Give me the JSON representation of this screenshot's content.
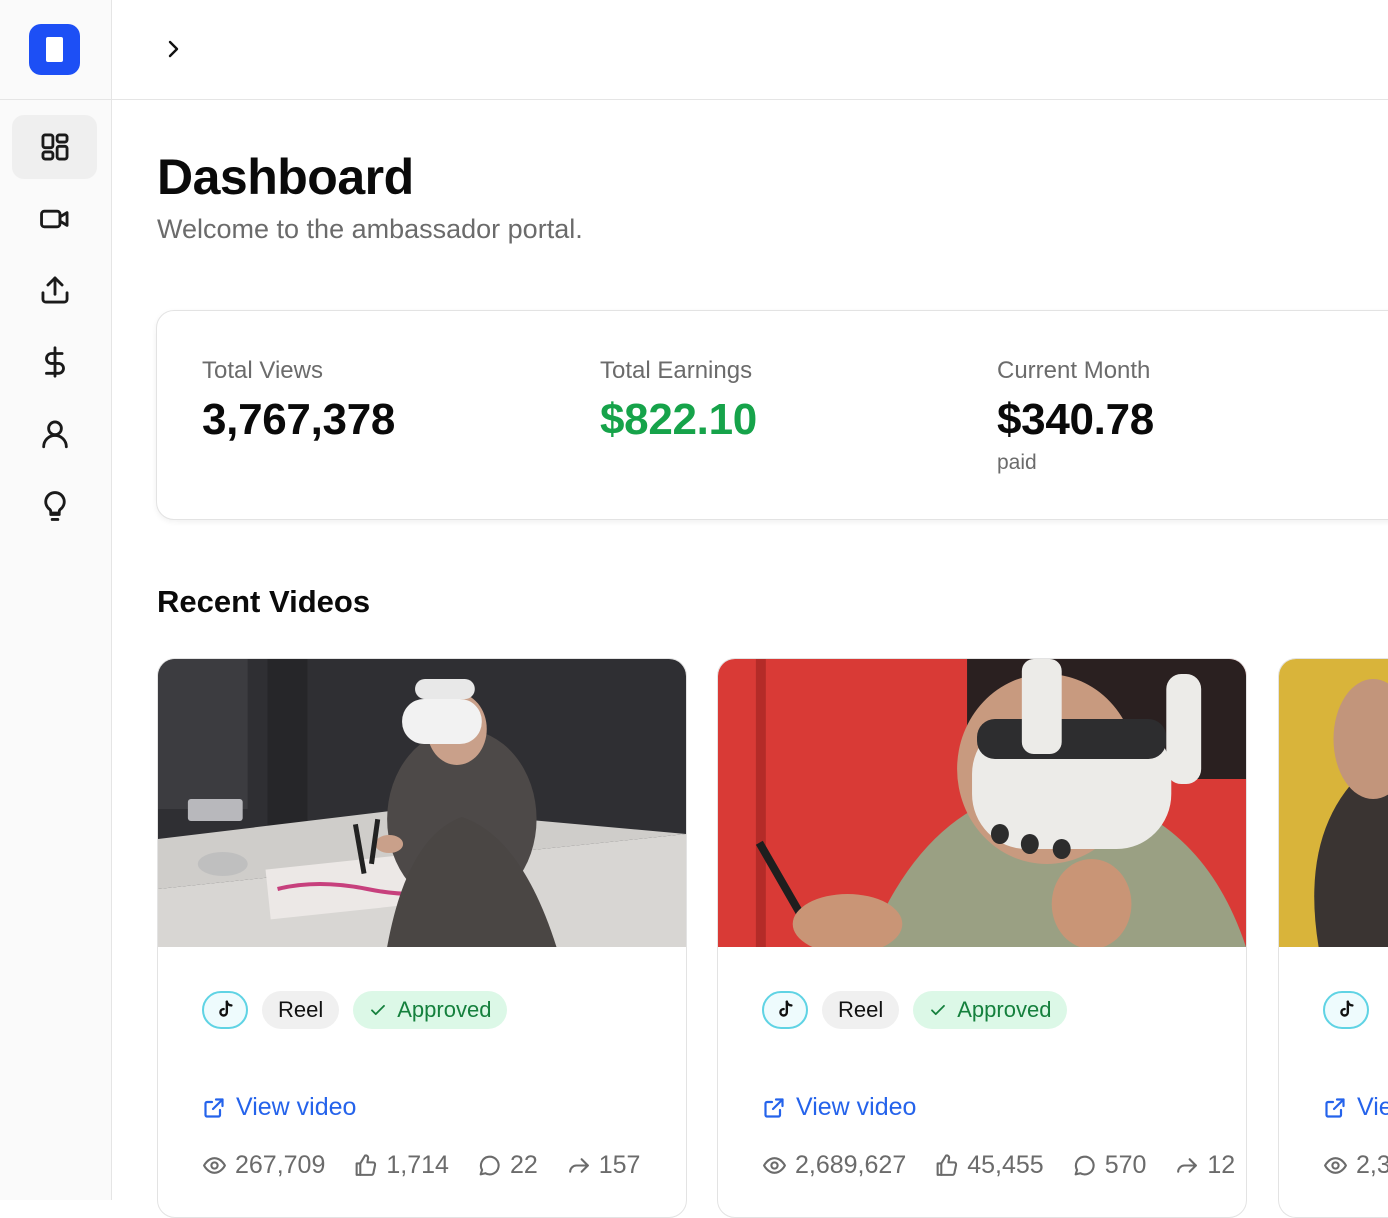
{
  "sidebar": {
    "items": [
      {
        "icon": "grid-icon",
        "active": true
      },
      {
        "icon": "video-camera-icon"
      },
      {
        "icon": "upload-icon"
      },
      {
        "icon": "dollar-icon"
      },
      {
        "icon": "user-icon"
      },
      {
        "icon": "lightbulb-icon"
      }
    ],
    "accent": "#1d4ff5"
  },
  "header": {
    "title": "Dashboard",
    "subtitle": "Welcome to the ambassador portal."
  },
  "stats": {
    "total_views_label": "Total Views",
    "total_views": "3,767,378",
    "total_earnings_label": "Total Earnings",
    "total_earnings": "$822.10",
    "current_month_label": "Current Month",
    "current_month": "$340.78",
    "current_month_note": "paid"
  },
  "recent": {
    "title": "Recent Videos",
    "videos": [
      {
        "platform_icon": "tiktok-icon",
        "type": "Reel",
        "status": "Approved",
        "link": "View video",
        "views": "267,709",
        "likes": "1,714",
        "comments": "22",
        "shares": "157"
      },
      {
        "platform_icon": "tiktok-icon",
        "type": "Reel",
        "status": "Approved",
        "link": "View video",
        "views": "2,689,627",
        "likes": "45,455",
        "comments": "570",
        "shares": "12"
      },
      {
        "platform_icon": "tiktok-icon",
        "link": "Vie",
        "views": "2,3"
      }
    ]
  },
  "colors": {
    "earnings_green": "#16a34a",
    "link_blue": "#2563eb",
    "approved_bg": "#dcf8e7"
  }
}
